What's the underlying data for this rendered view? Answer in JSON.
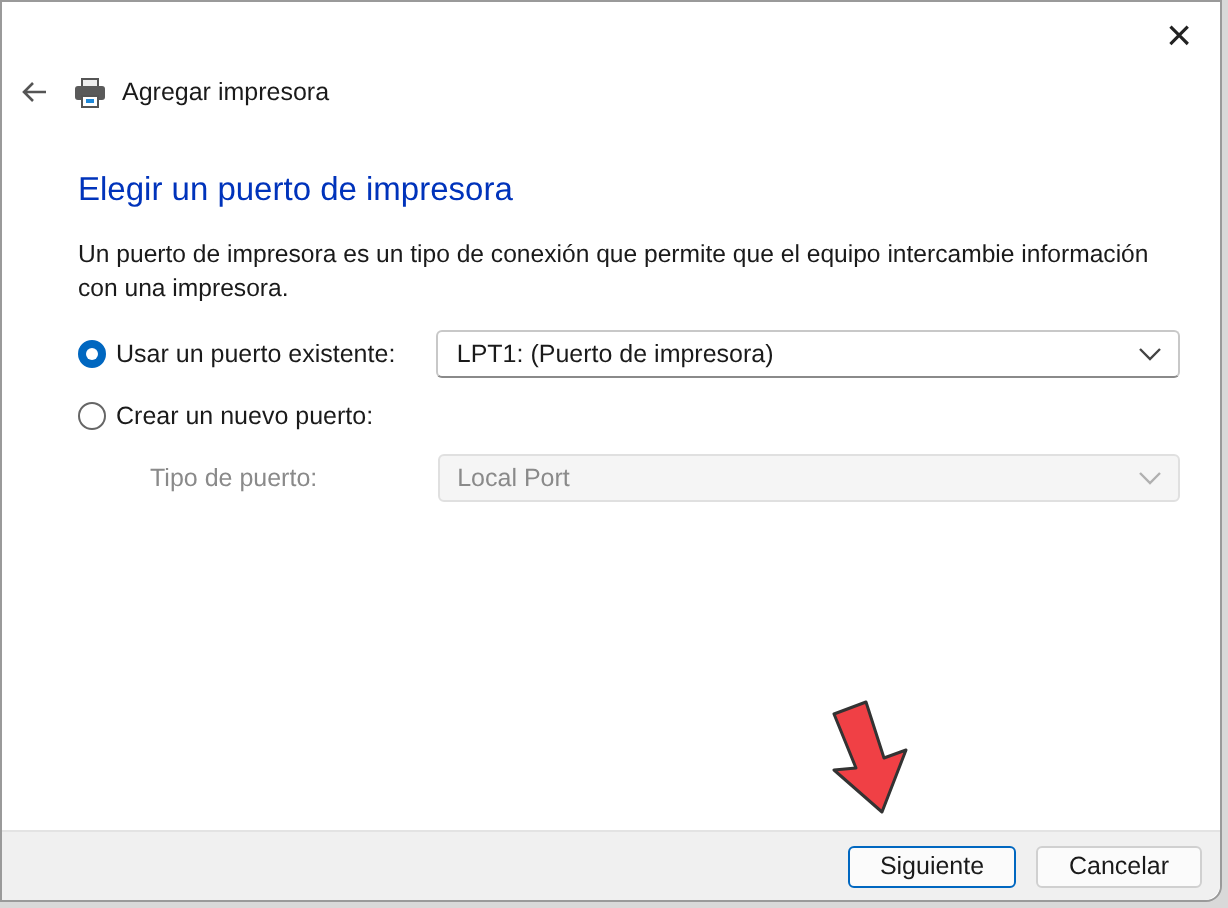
{
  "window": {
    "title": "Agregar impresora",
    "close": "×"
  },
  "heading": "Elegir un puerto de impresora",
  "description": "Un puerto de impresora es un tipo de conexión que permite que el equipo intercambie información con una impresora.",
  "options": [
    {
      "label": "Usar un puerto existente:",
      "selected": true,
      "combo": {
        "value": "LPT1: (Puerto de impresora)",
        "disabled": false
      }
    },
    {
      "label": "Crear un nuevo puerto:",
      "selected": false,
      "sub_label": "Tipo de puerto:",
      "combo": {
        "value": "Local Port",
        "disabled": true
      }
    }
  ],
  "buttons": [
    {
      "label": "Siguiente",
      "default": true
    },
    {
      "label": "Cancelar",
      "default": false
    }
  ]
}
